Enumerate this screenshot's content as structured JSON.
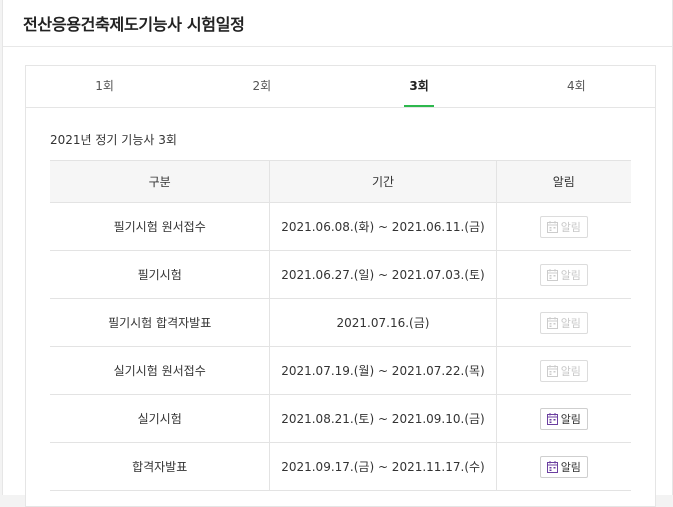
{
  "header": {
    "title": "전산응용건축제도기능사 시험일정"
  },
  "tabs": [
    {
      "label": "1회",
      "active": false
    },
    {
      "label": "2회",
      "active": false
    },
    {
      "label": "3회",
      "active": true
    },
    {
      "label": "4회",
      "active": false
    }
  ],
  "section": {
    "title": "2021년 정기 기능사 3회"
  },
  "table": {
    "headers": [
      "구분",
      "기간",
      "알림"
    ],
    "rows": [
      {
        "category": "필기시험 원서접수",
        "period": "2021.06.08.(화) ~ 2021.06.11.(금)",
        "alarm_label": "알림",
        "alarm_enabled": false
      },
      {
        "category": "필기시험",
        "period": "2021.06.27.(일) ~ 2021.07.03.(토)",
        "alarm_label": "알림",
        "alarm_enabled": false
      },
      {
        "category": "필기시험 합격자발표",
        "period": "2021.07.16.(금)",
        "alarm_label": "알림",
        "alarm_enabled": false
      },
      {
        "category": "실기시험 원서접수",
        "period": "2021.07.19.(월) ~ 2021.07.22.(목)",
        "alarm_label": "알림",
        "alarm_enabled": false
      },
      {
        "category": "실기시험",
        "period": "2021.08.21.(토) ~ 2021.09.10.(금)",
        "alarm_label": "알림",
        "alarm_enabled": true
      },
      {
        "category": "합격자발표",
        "period": "2021.09.17.(금) ~ 2021.11.17.(수)",
        "alarm_label": "알림",
        "alarm_enabled": true
      }
    ]
  },
  "colors": {
    "accent": "#2db84d",
    "icon_active": "#6b3fa0",
    "icon_disabled": "#cccccc"
  },
  "icons": {
    "alarm": "calendar-icon"
  }
}
